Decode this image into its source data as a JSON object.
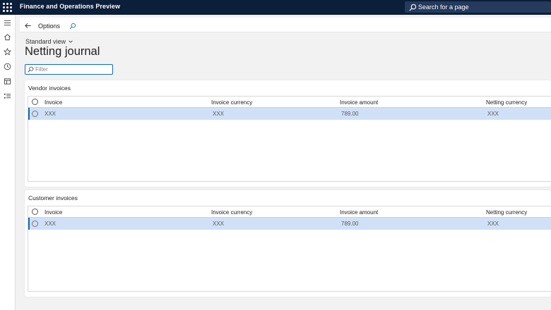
{
  "app": {
    "title": "Finance and Operations Preview"
  },
  "search": {
    "label": "Search for a page"
  },
  "actionpane": {
    "options_label": "Options"
  },
  "page": {
    "view_label": "Standard view",
    "title": "Netting journal"
  },
  "filter": {
    "placeholder": "Filter"
  },
  "vendor": {
    "title": "Vendor invoices",
    "columns": [
      "Invoice",
      "Invoice currency",
      "Invoice amount",
      "Netting currency"
    ],
    "rows": [
      [
        "XXX",
        "XXX",
        "789.00",
        "XXX"
      ]
    ]
  },
  "customer": {
    "title": "Customer invoices",
    "columns": [
      "Invoice",
      "Invoice currency",
      "Invoice amount",
      "Netting currency"
    ],
    "rows": [
      [
        "XXX",
        "XXX",
        "789.00",
        "XXX"
      ]
    ]
  },
  "icons": {
    "waffle": "app-launcher-icon",
    "hamburger": "hamburger-menu-icon",
    "home": "home-icon",
    "favorites": "star-icon",
    "recent": "clock-icon",
    "workspaces": "workspace-icon",
    "modules": "list-icon",
    "back": "back-arrow-icon",
    "search": "search-icon"
  },
  "colors": {
    "topbar": "#0b1e3a",
    "accent": "#0f6cbd",
    "selected_row": "#cfe0f7"
  }
}
